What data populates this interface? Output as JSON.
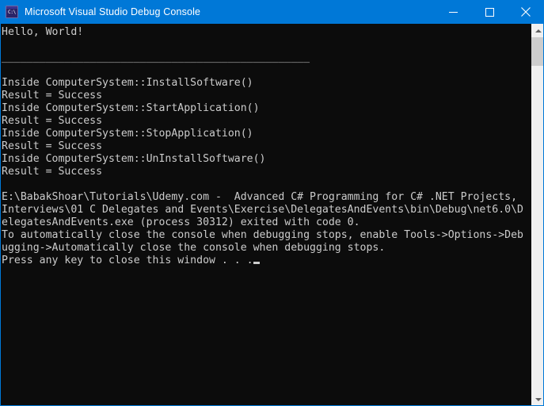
{
  "window": {
    "title": "Microsoft Visual Studio Debug Console",
    "icon": "console-window-icon",
    "icon_prompt_text": "C:\\",
    "titlebar_color": "#0078d7",
    "console_background": "#0c0c0c",
    "console_foreground": "#cccccc"
  },
  "controls": {
    "minimize_label": "Minimize",
    "maximize_label": "Maximize",
    "close_label": "Close"
  },
  "console": {
    "lines": [
      "Hello, World!",
      "",
      "_________________________________________________",
      "",
      "Inside ComputerSystem::InstallSoftware()",
      "Result = Success",
      "Inside ComputerSystem::StartApplication()",
      "Result = Success",
      "Inside ComputerSystem::StopApplication()",
      "Result = Success",
      "Inside ComputerSystem::UnInstallSoftware()",
      "Result = Success",
      "",
      "E:\\BabakShoar\\Tutorials\\Udemy.com -  Advanced C# Programming for C# .NET Projects,",
      "Interviews\\01 C Delegates and Events\\Exercise\\DelegatesAndEvents\\bin\\Debug\\net6.0\\D",
      "elegatesAndEvents.exe (process 30312) exited with code 0.",
      "To automatically close the console when debugging stops, enable Tools->Options->Deb",
      "ugging->Automatically close the console when debugging stops.",
      "Press any key to close this window . . ."
    ],
    "cursor_visible": true
  },
  "scrollbar": {
    "up_arrow": "chevron-up-icon",
    "down_arrow": "chevron-down-icon",
    "thumb_position_percent": 0,
    "track_color": "#f0f0f0",
    "thumb_color": "#cdcdcd"
  }
}
